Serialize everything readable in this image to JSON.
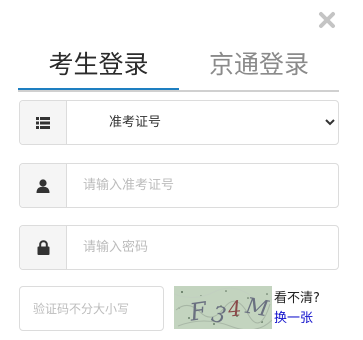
{
  "tabs": {
    "active_label": "考生登录",
    "inactive_label": "京通登录"
  },
  "login_type": {
    "selected": "准考证号",
    "options": [
      "准考证号"
    ]
  },
  "username": {
    "placeholder": "请输入准考证号",
    "value": ""
  },
  "password": {
    "placeholder": "请输入密码",
    "value": ""
  },
  "captcha": {
    "placeholder": "验证码不分大小写",
    "value": "",
    "image_text": [
      "F",
      "3",
      "4",
      "M"
    ],
    "hint": "看不清?",
    "refresh_label": "换一张"
  },
  "icons": {
    "close": "close-icon",
    "login_type": "list-icon",
    "username": "user-icon",
    "password": "lock-icon"
  },
  "colors": {
    "tab_active_underline": "#1e7fc1",
    "tab_active_text": "#2b2b2b",
    "tab_inactive_text": "#8a8a8a",
    "refresh_link": "#1111cc",
    "captcha_bg": "#b9cbb6"
  }
}
